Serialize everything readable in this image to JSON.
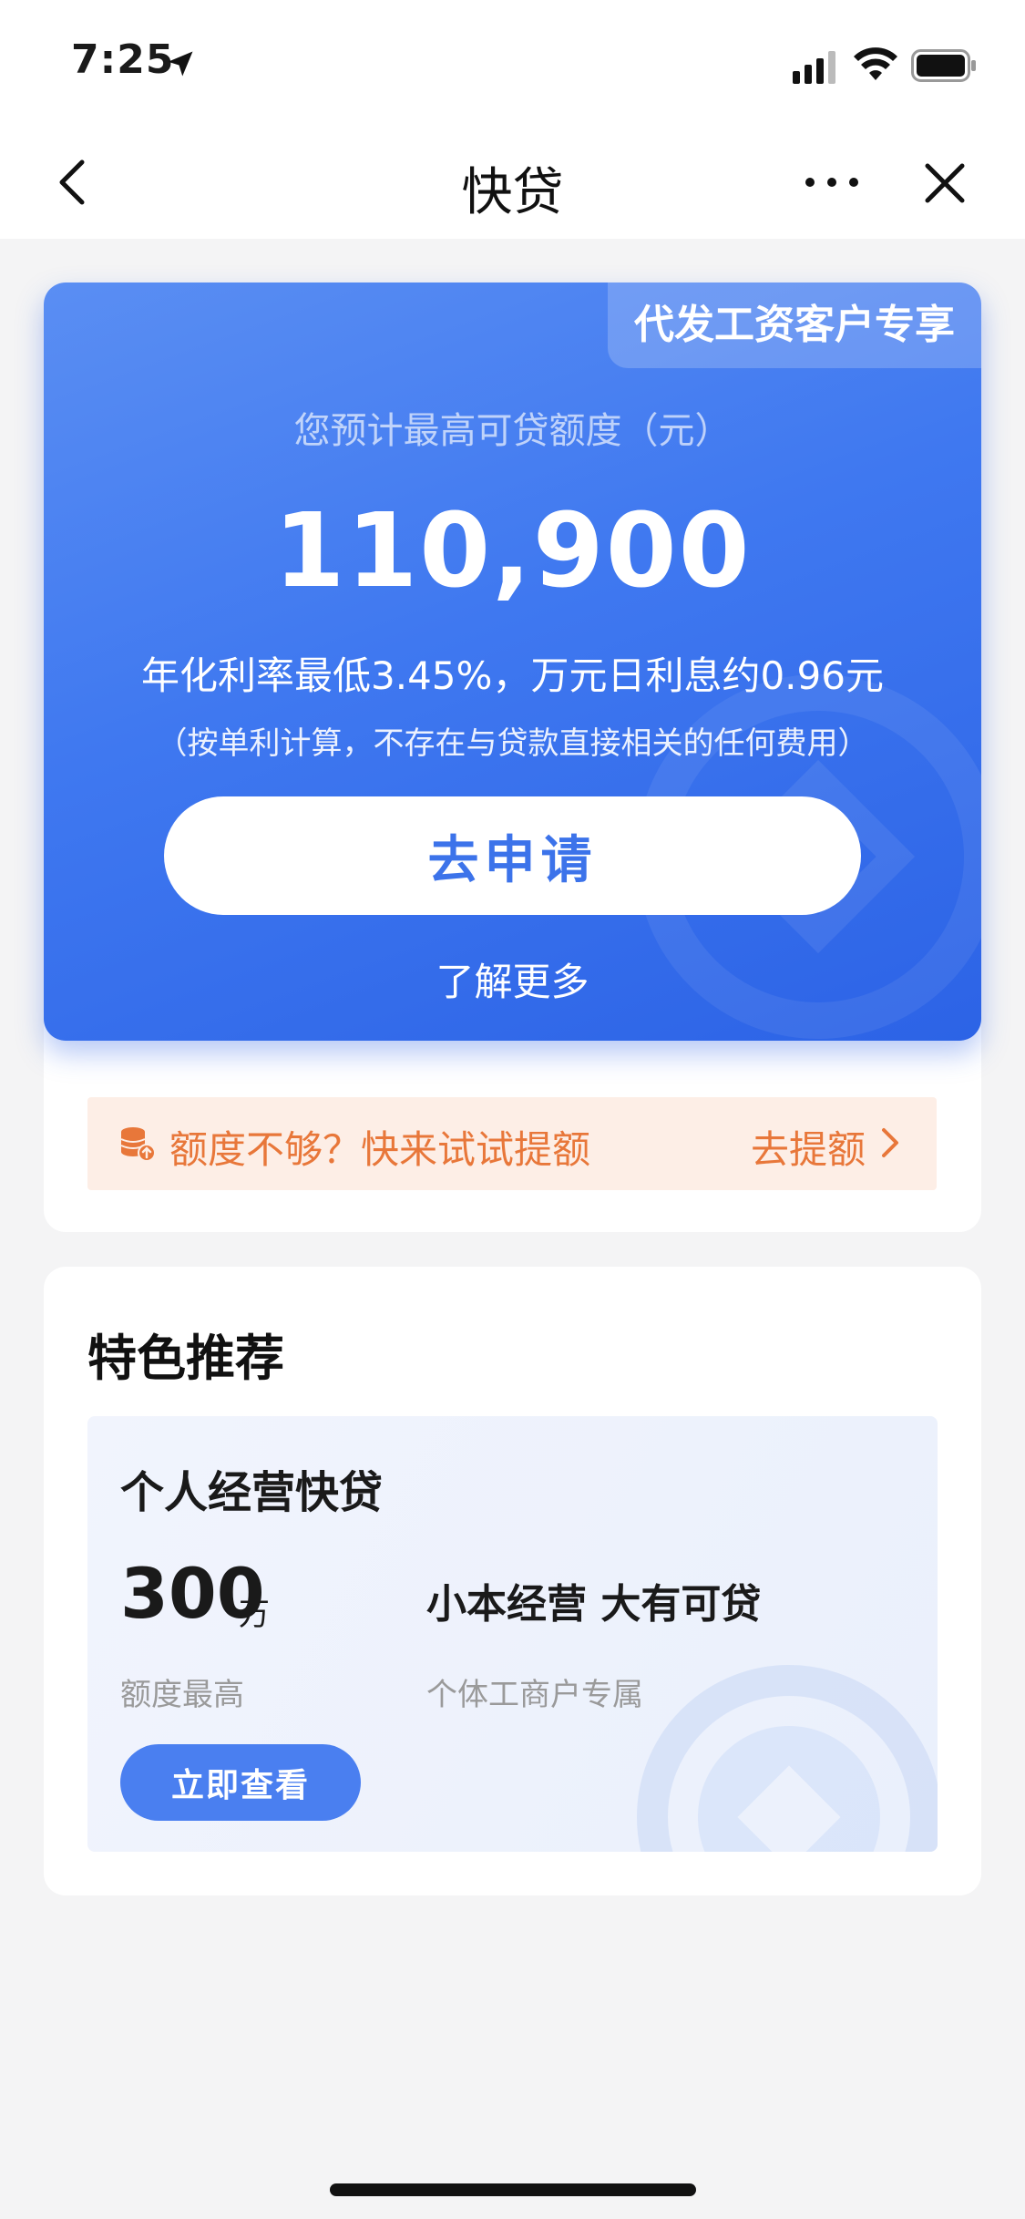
{
  "status_bar": {
    "time": "7:25",
    "icons": [
      "location-arrow-icon",
      "signal-icon",
      "wifi-icon",
      "battery-icon"
    ]
  },
  "nav": {
    "title": "快贷",
    "icons": [
      "back-icon",
      "more-icon",
      "close-icon"
    ]
  },
  "hero": {
    "badge": "代发工资客户专享",
    "subtitle": "您预计最高可贷额度（元）",
    "amount": "110,900",
    "rate_text": "年化利率最低3.45%，万元日利息约0.96元",
    "note": "（按单利计算，不存在与贷款直接相关的任何费用）",
    "apply_label": "去申请",
    "learn_more": "了解更多"
  },
  "quota": {
    "text": "额度不够？快来试试提额",
    "link": "去提额",
    "icon": "coin-stack-icon"
  },
  "featured": {
    "title": "特色推荐",
    "product": {
      "name": "个人经营快贷",
      "amount": "300",
      "unit": "万",
      "amount_label": "额度最高",
      "slogan": "小本经营 大有可贷",
      "slogan_sub": "个体工商户专属",
      "button_label": "立即查看"
    }
  },
  "colors": {
    "hero_blue": "#3f78f0",
    "button_blue": "#4a7ff0",
    "accent_orange": "#e8773a",
    "banner_bg": "#fdeee6"
  }
}
